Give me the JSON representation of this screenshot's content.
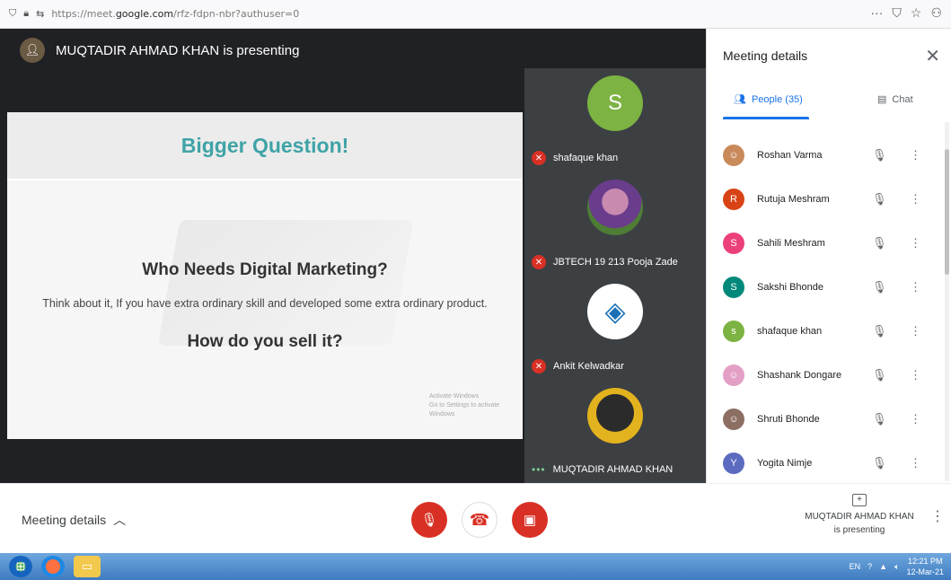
{
  "browser": {
    "url_prefix": "https://meet.",
    "url_domain": "google.com",
    "url_suffix": "/rfz-fdpn-nbr?authuser=0",
    "more": "···"
  },
  "stage": {
    "presenter_banner": "MUQTADIR AHMAD KHAN is presenting"
  },
  "slide": {
    "title": "Bigger Question!",
    "question1": "Who Needs Digital Marketing?",
    "body": "Think about it, If you have extra ordinary skill and developed some extra ordinary product.",
    "question2": "How do you sell it?",
    "activate_line1": "Activate Windows",
    "activate_line2": "Go to Settings to activate Windows"
  },
  "tiles": [
    {
      "name": "shafaque khan",
      "initial": "S",
      "color": "#7cb342"
    },
    {
      "name": "JBTECH 19 213 Pooja Zade",
      "initial": "",
      "color": "#6a3c8c"
    },
    {
      "name": "Ankit Kelwadkar",
      "initial": "",
      "color": "#ffffff"
    },
    {
      "name": "MUQTADIR AHMAD KHAN",
      "initial": "",
      "color": "#e3b21f"
    }
  ],
  "panel": {
    "title": "Meeting details",
    "tab_people": "People (35)",
    "tab_chat": "Chat",
    "people": [
      {
        "name": "Roshan Varma",
        "initial": "",
        "color": "#c98a5b"
      },
      {
        "name": "Rutuja Meshram",
        "initial": "R",
        "color": "#d84315"
      },
      {
        "name": "Sahili Meshram",
        "initial": "S",
        "color": "#ec407a"
      },
      {
        "name": "Sakshi Bhonde",
        "initial": "S",
        "color": "#00897b"
      },
      {
        "name": "shafaque khan",
        "initial": "s",
        "color": "#7cb342"
      },
      {
        "name": "Shashank Dongare",
        "initial": "",
        "color": "#e39fc6"
      },
      {
        "name": "Shruti Bhonde",
        "initial": "",
        "color": "#8d6e63"
      },
      {
        "name": "Yogita Nimje",
        "initial": "Y",
        "color": "#5c6bc0"
      }
    ]
  },
  "bottombar": {
    "meeting_details": "Meeting details",
    "presenting_name": "MUQTADIR AHMAD KHAN",
    "presenting_status": "is presenting"
  },
  "taskbar": {
    "lang": "EN",
    "time": "12:21 PM",
    "date": "12-Mar-21"
  },
  "colors": {
    "accent": "#1a73e8",
    "danger": "#d93025",
    "slide_title": "#3fa3a7"
  }
}
